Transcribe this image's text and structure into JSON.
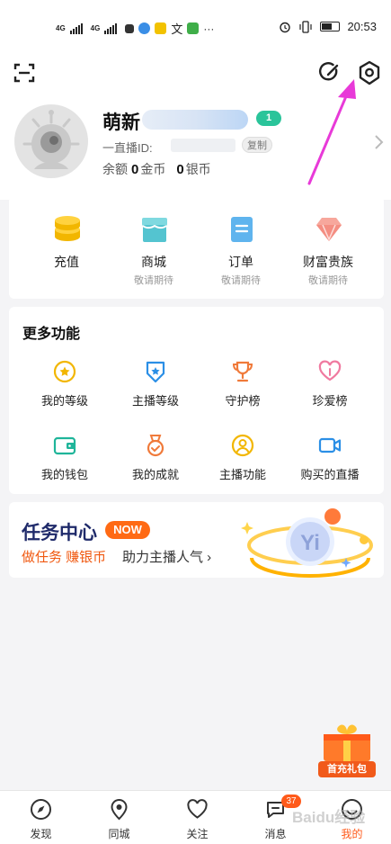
{
  "status_bar": {
    "signal_1": "4G",
    "signal_2": "4G",
    "time": "20:53"
  },
  "profile": {
    "username": "萌新",
    "level": "1",
    "id_label": "一直播ID:",
    "copy_label": "复制",
    "balance_label": "余额",
    "gold_value": "0",
    "gold_unit": "金币",
    "silver_value": "0",
    "silver_unit": "银币"
  },
  "quick_actions": [
    {
      "label": "充值",
      "sub": "",
      "icon": "coins-icon"
    },
    {
      "label": "商城",
      "sub": "敬请期待",
      "icon": "store-icon"
    },
    {
      "label": "订单",
      "sub": "敬请期待",
      "icon": "order-icon"
    },
    {
      "label": "财富贵族",
      "sub": "敬请期待",
      "icon": "diamond-icon"
    }
  ],
  "more_functions": {
    "title": "更多功能",
    "items": [
      {
        "label": "我的等级",
        "icon": "star-medal-icon"
      },
      {
        "label": "主播等级",
        "icon": "star-shield-icon"
      },
      {
        "label": "守护榜",
        "icon": "trophy-icon"
      },
      {
        "label": "珍爱榜",
        "icon": "heart-icon"
      },
      {
        "label": "我的钱包",
        "icon": "wallet-icon"
      },
      {
        "label": "我的成就",
        "icon": "achievement-icon"
      },
      {
        "label": "主播功能",
        "icon": "person-icon"
      },
      {
        "label": "购买的直播",
        "icon": "video-icon"
      }
    ]
  },
  "task_center": {
    "title": "任务中心",
    "badge": "NOW",
    "sub_highlight": "做任务 赚银币",
    "sub_text": "助力主播人气"
  },
  "gift_float": {
    "label": "首充礼包"
  },
  "tabbar": {
    "tabs": [
      {
        "label": "发现",
        "icon": "compass-icon"
      },
      {
        "label": "同城",
        "icon": "location-icon"
      },
      {
        "label": "关注",
        "icon": "heart-outline-icon"
      },
      {
        "label": "消息",
        "icon": "chat-icon",
        "badge": "37"
      },
      {
        "label": "我的",
        "icon": "profile-icon",
        "active": true
      }
    ]
  },
  "watermark": "Baidu经验",
  "colors": {
    "accent": "#ff5a1a",
    "level_badge": "#2ac49a",
    "annotation_arrow": "#e83ad8"
  }
}
